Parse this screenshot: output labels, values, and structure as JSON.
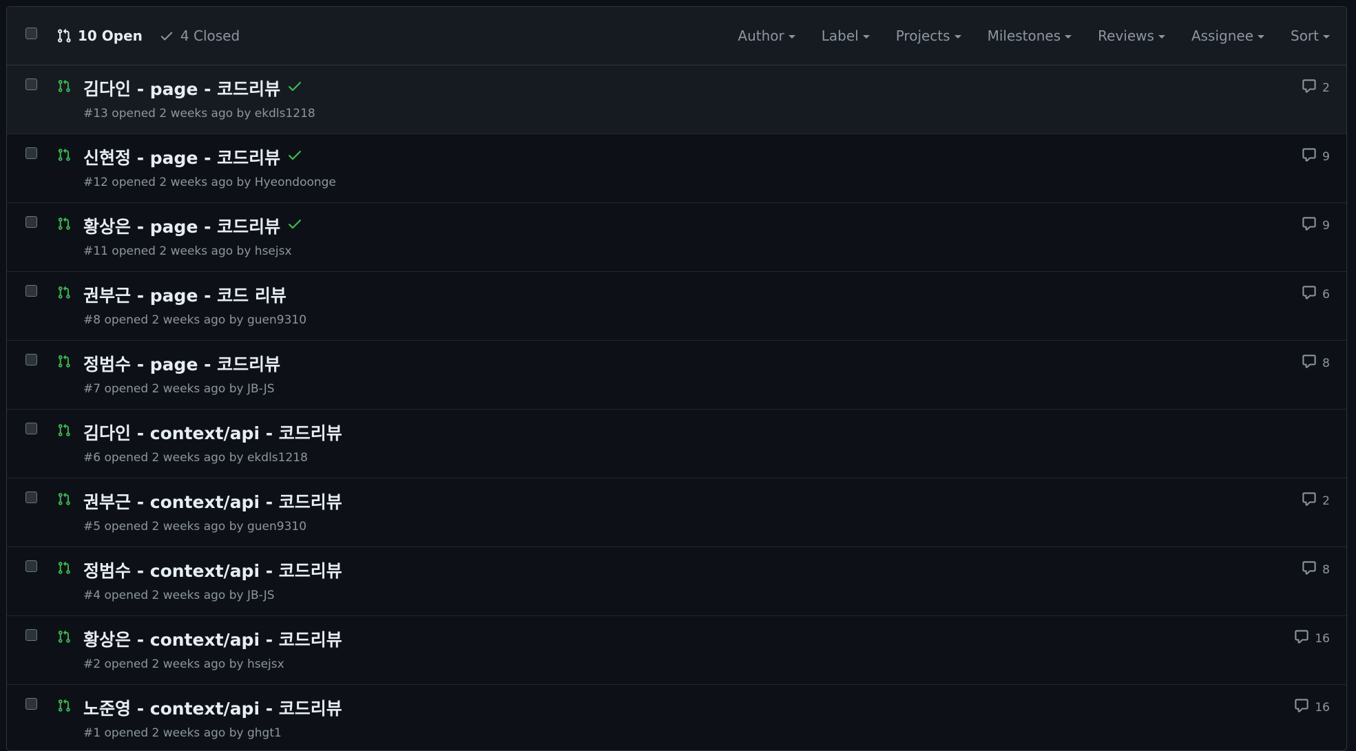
{
  "header": {
    "open_label": "10 Open",
    "closed_label": "4 Closed",
    "filters": [
      "Author",
      "Label",
      "Projects",
      "Milestones",
      "Reviews",
      "Assignee",
      "Sort"
    ]
  },
  "colors": {
    "open_green": "#3fb950",
    "muted": "#8d96a0",
    "background": "#0d1117",
    "header_bg": "#161b22"
  },
  "icons": {
    "pr": "git-pull-request-icon",
    "check": "check-icon",
    "comment": "comment-icon"
  },
  "pull_requests": [
    {
      "title": "김다인 - page - 코드리뷰",
      "checked": true,
      "number": "#13",
      "opened": "opened 2 weeks ago by",
      "author": "ekdls1218",
      "comments": "2"
    },
    {
      "title": "신현정 - page - 코드리뷰",
      "checked": true,
      "number": "#12",
      "opened": "opened 2 weeks ago by",
      "author": "Hyeondoonge",
      "comments": "9"
    },
    {
      "title": "황상은 - page - 코드리뷰",
      "checked": true,
      "number": "#11",
      "opened": "opened 2 weeks ago by",
      "author": "hsejsx",
      "comments": "9"
    },
    {
      "title": "권부근 - page - 코드 리뷰",
      "checked": false,
      "number": "#8",
      "opened": "opened 2 weeks ago by",
      "author": "guen9310",
      "comments": "6"
    },
    {
      "title": "정범수 - page - 코드리뷰",
      "checked": false,
      "number": "#7",
      "opened": "opened 2 weeks ago by",
      "author": "JB-JS",
      "comments": "8"
    },
    {
      "title": "김다인 - context/api - 코드리뷰",
      "checked": false,
      "number": "#6",
      "opened": "opened 2 weeks ago by",
      "author": "ekdls1218",
      "comments": ""
    },
    {
      "title": "권부근 - context/api - 코드리뷰",
      "checked": false,
      "number": "#5",
      "opened": "opened 2 weeks ago by",
      "author": "guen9310",
      "comments": "2"
    },
    {
      "title": "정범수 - context/api - 코드리뷰",
      "checked": false,
      "number": "#4",
      "opened": "opened 2 weeks ago by",
      "author": "JB-JS",
      "comments": "8"
    },
    {
      "title": "황상은 - context/api - 코드리뷰",
      "checked": false,
      "number": "#2",
      "opened": "opened 2 weeks ago by",
      "author": "hsejsx",
      "comments": "16"
    },
    {
      "title": "노준영 - context/api - 코드리뷰",
      "checked": false,
      "number": "#1",
      "opened": "opened 2 weeks ago by",
      "author": "ghgt1",
      "comments": "16"
    }
  ]
}
